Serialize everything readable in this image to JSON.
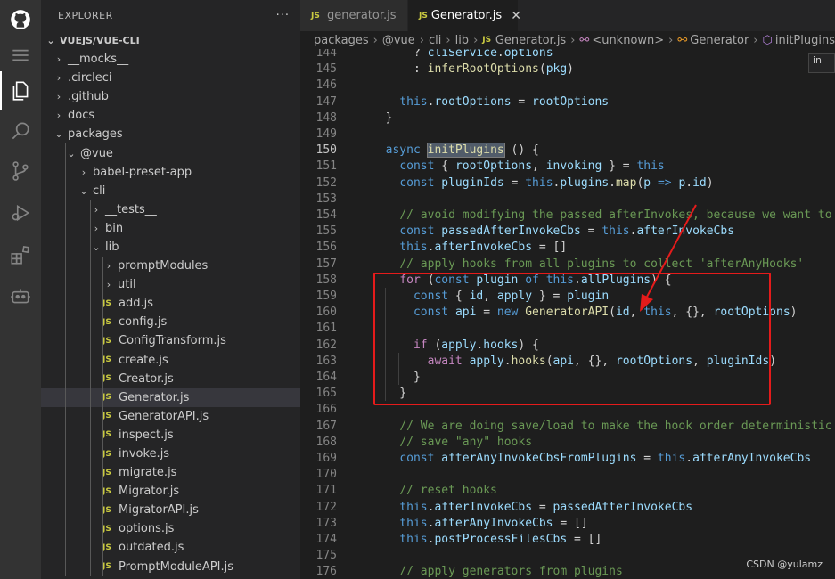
{
  "activity_bar": {
    "icons": [
      "github-icon",
      "menu-icon",
      "files-icon",
      "search-icon",
      "source-control-icon",
      "run-debug-icon",
      "extensions-icon",
      "robot-icon"
    ]
  },
  "sidebar": {
    "title": "EXPLORER",
    "more": "···",
    "root": "VUEJS/VUE-CLI",
    "items": [
      {
        "label": "__mocks__",
        "type": "folder",
        "open": false,
        "depth": 0
      },
      {
        "label": ".circleci",
        "type": "folder",
        "open": false,
        "depth": 0
      },
      {
        "label": ".github",
        "type": "folder",
        "open": false,
        "depth": 0
      },
      {
        "label": "docs",
        "type": "folder",
        "open": false,
        "depth": 0
      },
      {
        "label": "packages",
        "type": "folder",
        "open": true,
        "depth": 0
      },
      {
        "label": "@vue",
        "type": "folder",
        "open": true,
        "depth": 1
      },
      {
        "label": "babel-preset-app",
        "type": "folder",
        "open": false,
        "depth": 2
      },
      {
        "label": "cli",
        "type": "folder",
        "open": true,
        "depth": 2
      },
      {
        "label": "__tests__",
        "type": "folder",
        "open": false,
        "depth": 3
      },
      {
        "label": "bin",
        "type": "folder",
        "open": false,
        "depth": 3
      },
      {
        "label": "lib",
        "type": "folder",
        "open": true,
        "depth": 3
      },
      {
        "label": "promptModules",
        "type": "folder",
        "open": false,
        "depth": 4
      },
      {
        "label": "util",
        "type": "folder",
        "open": false,
        "depth": 4
      },
      {
        "label": "add.js",
        "type": "js",
        "depth": 4
      },
      {
        "label": "config.js",
        "type": "js",
        "depth": 4
      },
      {
        "label": "ConfigTransform.js",
        "type": "js",
        "depth": 4
      },
      {
        "label": "create.js",
        "type": "js",
        "depth": 4
      },
      {
        "label": "Creator.js",
        "type": "js",
        "depth": 4
      },
      {
        "label": "Generator.js",
        "type": "js",
        "depth": 4,
        "selected": true
      },
      {
        "label": "GeneratorAPI.js",
        "type": "js",
        "depth": 4
      },
      {
        "label": "inspect.js",
        "type": "js",
        "depth": 4
      },
      {
        "label": "invoke.js",
        "type": "js",
        "depth": 4
      },
      {
        "label": "migrate.js",
        "type": "js",
        "depth": 4
      },
      {
        "label": "Migrator.js",
        "type": "js",
        "depth": 4
      },
      {
        "label": "MigratorAPI.js",
        "type": "js",
        "depth": 4
      },
      {
        "label": "options.js",
        "type": "js",
        "depth": 4
      },
      {
        "label": "outdated.js",
        "type": "js",
        "depth": 4
      },
      {
        "label": "PromptModuleAPI.js",
        "type": "js",
        "depth": 4
      }
    ]
  },
  "tabs": [
    {
      "label": "generator.js",
      "active": false
    },
    {
      "label": "Generator.js",
      "active": true
    }
  ],
  "js_badge": "JS",
  "close_glyph": "✕",
  "breadcrumbs": [
    "packages",
    "@vue",
    "cli",
    "lib",
    "Generator.js",
    "<unknown>",
    "Generator",
    "initPlugins"
  ],
  "hover_tip": "in",
  "editor": {
    "current_line": 150,
    "lines": [
      {
        "n": 144,
        "tokens": [
          [
            "      ? ",
            ""
          ],
          [
            "cliService",
            "var"
          ],
          [
            ".",
            ""
          ],
          [
            "options",
            "var"
          ]
        ]
      },
      {
        "n": 145,
        "tokens": [
          [
            "      : ",
            ""
          ],
          [
            "inferRootOptions",
            "fn"
          ],
          [
            "(",
            ""
          ],
          [
            "pkg",
            "var"
          ],
          [
            ")",
            ""
          ]
        ]
      },
      {
        "n": 146,
        "tokens": []
      },
      {
        "n": 147,
        "tokens": [
          [
            "    ",
            ""
          ],
          [
            "this",
            "kw"
          ],
          [
            ".",
            ""
          ],
          [
            "rootOptions",
            "var"
          ],
          [
            " = ",
            ""
          ],
          [
            "rootOptions",
            "var"
          ]
        ]
      },
      {
        "n": 148,
        "tokens": [
          [
            "  }",
            ""
          ]
        ]
      },
      {
        "n": 149,
        "tokens": []
      },
      {
        "n": 150,
        "tokens": [
          [
            "  ",
            ""
          ],
          [
            "async",
            "kw"
          ],
          [
            " ",
            ""
          ],
          [
            "initPlugins",
            "fn hl"
          ],
          [
            " () {",
            ""
          ]
        ]
      },
      {
        "n": 151,
        "tokens": [
          [
            "    ",
            ""
          ],
          [
            "const",
            "kw"
          ],
          [
            " { ",
            ""
          ],
          [
            "rootOptions",
            "var"
          ],
          [
            ", ",
            ""
          ],
          [
            "invoking",
            "var"
          ],
          [
            " } = ",
            ""
          ],
          [
            "this",
            "kw"
          ]
        ]
      },
      {
        "n": 152,
        "tokens": [
          [
            "    ",
            ""
          ],
          [
            "const",
            "kw"
          ],
          [
            " ",
            ""
          ],
          [
            "pluginIds",
            "var"
          ],
          [
            " = ",
            ""
          ],
          [
            "this",
            "kw"
          ],
          [
            ".",
            ""
          ],
          [
            "plugins",
            "var"
          ],
          [
            ".",
            ""
          ],
          [
            "map",
            "fn"
          ],
          [
            "(",
            ""
          ],
          [
            "p",
            "var"
          ],
          [
            " ",
            ""
          ],
          [
            "=>",
            "kw"
          ],
          [
            " ",
            ""
          ],
          [
            "p",
            "var"
          ],
          [
            ".",
            ""
          ],
          [
            "id",
            "var"
          ],
          [
            ")",
            ""
          ]
        ]
      },
      {
        "n": 153,
        "tokens": []
      },
      {
        "n": 154,
        "tokens": [
          [
            "    ",
            ""
          ],
          [
            "// avoid modifying the passed afterInvokes, because we want to ignore",
            "cm"
          ]
        ]
      },
      {
        "n": 155,
        "tokens": [
          [
            "    ",
            ""
          ],
          [
            "const",
            "kw"
          ],
          [
            " ",
            ""
          ],
          [
            "passedAfterInvokeCbs",
            "var"
          ],
          [
            " = ",
            ""
          ],
          [
            "this",
            "kw"
          ],
          [
            ".",
            ""
          ],
          [
            "afterInvokeCbs",
            "var"
          ]
        ]
      },
      {
        "n": 156,
        "tokens": [
          [
            "    ",
            ""
          ],
          [
            "this",
            "kw"
          ],
          [
            ".",
            ""
          ],
          [
            "afterInvokeCbs",
            "var"
          ],
          [
            " = []",
            ""
          ]
        ]
      },
      {
        "n": 157,
        "tokens": [
          [
            "    ",
            ""
          ],
          [
            "// apply hooks from all plugins to collect 'afterAnyHooks'",
            "cm"
          ]
        ]
      },
      {
        "n": 158,
        "tokens": [
          [
            "    ",
            ""
          ],
          [
            "for",
            "kw2"
          ],
          [
            " (",
            ""
          ],
          [
            "const",
            "kw"
          ],
          [
            " ",
            ""
          ],
          [
            "plugin",
            "var"
          ],
          [
            " ",
            ""
          ],
          [
            "of",
            "kw"
          ],
          [
            " ",
            ""
          ],
          [
            "this",
            "kw"
          ],
          [
            ".",
            ""
          ],
          [
            "allPlugins",
            "var"
          ],
          [
            ") {",
            ""
          ]
        ]
      },
      {
        "n": 159,
        "tokens": [
          [
            "      ",
            ""
          ],
          [
            "const",
            "kw"
          ],
          [
            " { ",
            ""
          ],
          [
            "id",
            "var"
          ],
          [
            ", ",
            ""
          ],
          [
            "apply",
            "var"
          ],
          [
            " } = ",
            ""
          ],
          [
            "plugin",
            "var"
          ]
        ]
      },
      {
        "n": 160,
        "tokens": [
          [
            "      ",
            ""
          ],
          [
            "const",
            "kw"
          ],
          [
            " ",
            ""
          ],
          [
            "api",
            "var"
          ],
          [
            " = ",
            ""
          ],
          [
            "new",
            "kw"
          ],
          [
            " ",
            ""
          ],
          [
            "GeneratorAPI",
            "fn"
          ],
          [
            "(",
            ""
          ],
          [
            "id",
            "var"
          ],
          [
            ", ",
            ""
          ],
          [
            "this",
            "kw"
          ],
          [
            ", {}, ",
            ""
          ],
          [
            "rootOptions",
            "var"
          ],
          [
            ")",
            ""
          ]
        ]
      },
      {
        "n": 161,
        "tokens": []
      },
      {
        "n": 162,
        "tokens": [
          [
            "      ",
            ""
          ],
          [
            "if",
            "kw2"
          ],
          [
            " (",
            ""
          ],
          [
            "apply",
            "var"
          ],
          [
            ".",
            ""
          ],
          [
            "hooks",
            "var"
          ],
          [
            ") {",
            ""
          ]
        ]
      },
      {
        "n": 163,
        "tokens": [
          [
            "        ",
            ""
          ],
          [
            "await",
            "kw2"
          ],
          [
            " ",
            ""
          ],
          [
            "apply",
            "var"
          ],
          [
            ".",
            ""
          ],
          [
            "hooks",
            "fn"
          ],
          [
            "(",
            ""
          ],
          [
            "api",
            "var"
          ],
          [
            ", {}, ",
            ""
          ],
          [
            "rootOptions",
            "var"
          ],
          [
            ", ",
            ""
          ],
          [
            "pluginIds",
            "var"
          ],
          [
            ")",
            ""
          ]
        ]
      },
      {
        "n": 164,
        "tokens": [
          [
            "      }",
            ""
          ]
        ]
      },
      {
        "n": 165,
        "tokens": [
          [
            "    }",
            ""
          ]
        ]
      },
      {
        "n": 166,
        "tokens": []
      },
      {
        "n": 167,
        "tokens": [
          [
            "    ",
            ""
          ],
          [
            "// We are doing save/load to make the hook order deterministic",
            "cm"
          ]
        ]
      },
      {
        "n": 168,
        "tokens": [
          [
            "    ",
            ""
          ],
          [
            "// save \"any\" hooks",
            "cm"
          ]
        ]
      },
      {
        "n": 169,
        "tokens": [
          [
            "    ",
            ""
          ],
          [
            "const",
            "kw"
          ],
          [
            " ",
            ""
          ],
          [
            "afterAnyInvokeCbsFromPlugins",
            "var"
          ],
          [
            " = ",
            ""
          ],
          [
            "this",
            "kw"
          ],
          [
            ".",
            ""
          ],
          [
            "afterAnyInvokeCbs",
            "var"
          ]
        ]
      },
      {
        "n": 170,
        "tokens": []
      },
      {
        "n": 171,
        "tokens": [
          [
            "    ",
            ""
          ],
          [
            "// reset hooks",
            "cm"
          ]
        ]
      },
      {
        "n": 172,
        "tokens": [
          [
            "    ",
            ""
          ],
          [
            "this",
            "kw"
          ],
          [
            ".",
            ""
          ],
          [
            "afterInvokeCbs",
            "var"
          ],
          [
            " = ",
            ""
          ],
          [
            "passedAfterInvokeCbs",
            "var"
          ]
        ]
      },
      {
        "n": 173,
        "tokens": [
          [
            "    ",
            ""
          ],
          [
            "this",
            "kw"
          ],
          [
            ".",
            ""
          ],
          [
            "afterAnyInvokeCbs",
            "var"
          ],
          [
            " = []",
            ""
          ]
        ]
      },
      {
        "n": 174,
        "tokens": [
          [
            "    ",
            ""
          ],
          [
            "this",
            "kw"
          ],
          [
            ".",
            ""
          ],
          [
            "postProcessFilesCbs",
            "var"
          ],
          [
            " = []",
            ""
          ]
        ]
      },
      {
        "n": 175,
        "tokens": []
      },
      {
        "n": 176,
        "tokens": [
          [
            "    ",
            ""
          ],
          [
            "// apply generators from plugins",
            "cm"
          ]
        ]
      }
    ]
  },
  "watermark": "CSDN @yulamz"
}
